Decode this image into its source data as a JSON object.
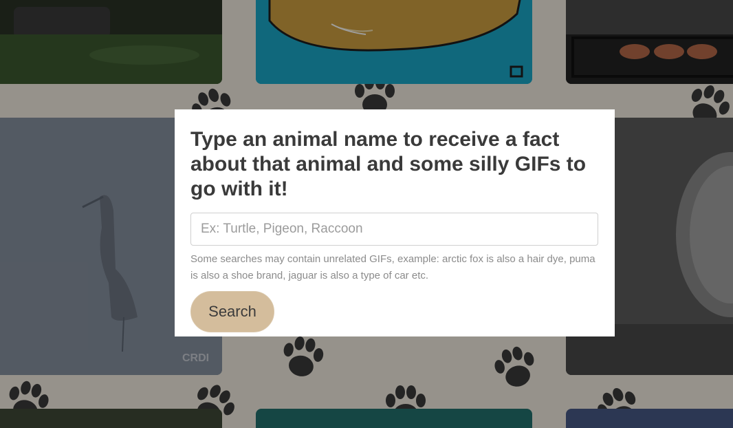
{
  "modal": {
    "title": "Type an animal name to receive a fact about that animal and some silly GIFs to go with it!",
    "input_placeholder": "Ex: Turtle, Pigeon, Raccoon",
    "input_value": "",
    "help_text": "Some searches may contain unrelated GIFs, example: arctic fox is also a hair dye, puma is also a shoe brand, jaguar is also a type of car etc.",
    "search_label": "Search"
  },
  "background": {
    "watermark": "CRDI"
  },
  "colors": {
    "page_background": "#f3ece1",
    "paw_print": "#3a3a3a",
    "button_background": "#d4bd9c",
    "modal_background": "#ffffff"
  }
}
